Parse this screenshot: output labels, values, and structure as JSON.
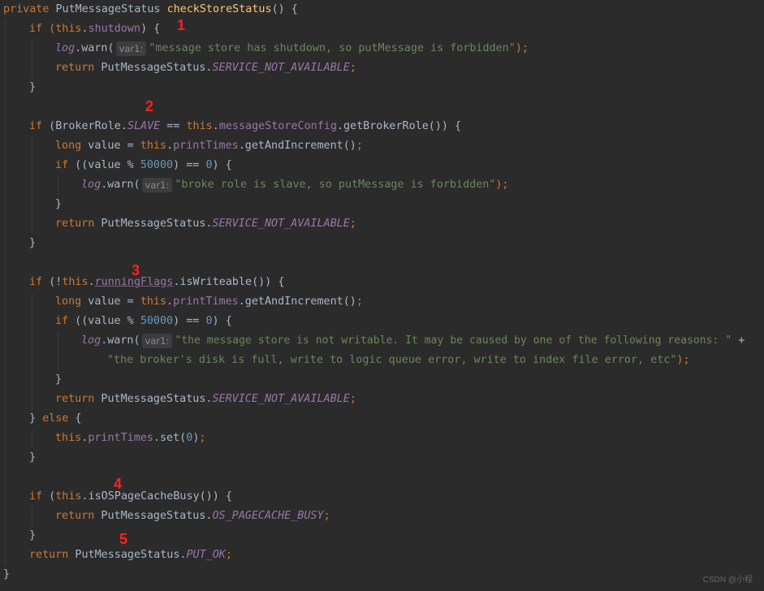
{
  "code": {
    "method_decl": {
      "kw": "private",
      "type": "PutMessageStatus",
      "name": "checkStoreStatus",
      "tail": "() {"
    },
    "if1": {
      "head": "if (",
      "this": "this",
      "field": "shutdown",
      "tail": ") {"
    },
    "warn1": {
      "log": "log",
      "call": ".warn(",
      "hint": "var1:",
      "str": "\"message store has shutdown, so putMessage is forbidden\"",
      "end": ");"
    },
    "ret1": {
      "kw": "return",
      "cls": " PutMessageStatus.",
      "val": "SERVICE_NOT_AVAILABLE",
      "end": ";"
    },
    "close_brace": "}",
    "if2": {
      "head": "if (BrokerRole.",
      "slave": "SLAVE",
      "mid": " == ",
      "this": "this",
      "field": ".messageStoreConfig",
      "tail": ".getBrokerRole()) {"
    },
    "long_line": {
      "kw": "long",
      "mid": " value = ",
      "this": "this",
      "field": ".printTimes",
      "tail": ".getAndIncrement();"
    },
    "mod_if": {
      "kw": "if",
      "head": " ((value % ",
      "num": "50000",
      "mid": ") == ",
      "zero": "0",
      "tail": ") {"
    },
    "warn2": {
      "log": "log",
      "call": ".warn(",
      "hint": "var1:",
      "str": "\"broke role is slave, so putMessage is forbidden\"",
      "end": ");"
    },
    "if3": {
      "head": "if (!",
      "this": "this",
      "field": ".runningFlags",
      "tail": ".isWriteable()) {"
    },
    "warn3": {
      "log": "log",
      "call": ".warn(",
      "hint": "var1:",
      "str": "\"the message store is not writable. It may be caused by one of the following reasons: \"",
      "plus": " +"
    },
    "warn3b": {
      "str": "\"the broker's disk is full, write to logic queue error, write to index file error, etc\"",
      "end": ");"
    },
    "else_line": {
      "open": "} ",
      "kw": "else",
      "tail": " {"
    },
    "set_line": {
      "this": "this",
      "field": ".printTimes",
      "tail": ".set(",
      "zero": "0",
      "end": ");"
    },
    "if4": {
      "head": "if (",
      "this": "this",
      "tail": ".isOSPageCacheBusy()) {"
    },
    "ret4": {
      "kw": "return",
      "cls": " PutMessageStatus.",
      "val": "OS_PAGECACHE_BUSY",
      "end": ";"
    },
    "ret5": {
      "kw": "return",
      "cls": " PutMessageStatus.",
      "val": "PUT_OK",
      "end": ";"
    }
  },
  "markers": [
    "1",
    "2",
    "3",
    "4",
    "5"
  ],
  "watermark": "CSDN @小程"
}
